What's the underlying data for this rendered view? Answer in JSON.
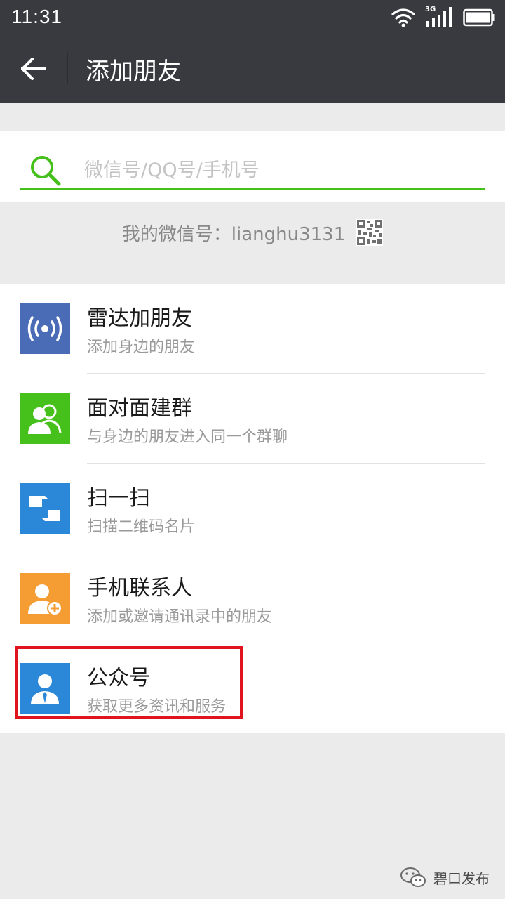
{
  "status_bar": {
    "time": "11:31",
    "network_label": "3G",
    "icons": [
      "wifi-icon",
      "signal-icon",
      "battery-icon"
    ]
  },
  "header": {
    "title": "添加朋友",
    "back_icon": "arrow-left-icon"
  },
  "search": {
    "placeholder": "微信号/QQ号/手机号",
    "accent_color": "#45c01a"
  },
  "my_wechat_id": {
    "label": "我的微信号：lianghu3131",
    "icon": "qr-code-icon"
  },
  "list": {
    "items": [
      {
        "title": "雷达加朋友",
        "subtitle": "添加身边的朋友",
        "icon": "radar-icon",
        "icon_bg": "#4a6bb5"
      },
      {
        "title": "面对面建群",
        "subtitle": "与身边的朋友进入同一个群聊",
        "icon": "group-icon",
        "icon_bg": "#46c01b"
      },
      {
        "title": "扫一扫",
        "subtitle": "扫描二维码名片",
        "icon": "scan-icon",
        "icon_bg": "#2b87d8"
      },
      {
        "title": "手机联系人",
        "subtitle": "添加或邀请通讯录中的朋友",
        "icon": "contact-add-icon",
        "icon_bg": "#f59c32"
      },
      {
        "title": "公众号",
        "subtitle": "获取更多资讯和服务",
        "icon": "official-account-icon",
        "icon_bg": "#2b87d8"
      }
    ]
  },
  "highlight": {
    "color": "#e0141e",
    "target": "公众号"
  },
  "watermark": {
    "text": "碧口发布",
    "icon": "wechat-logo-icon"
  }
}
